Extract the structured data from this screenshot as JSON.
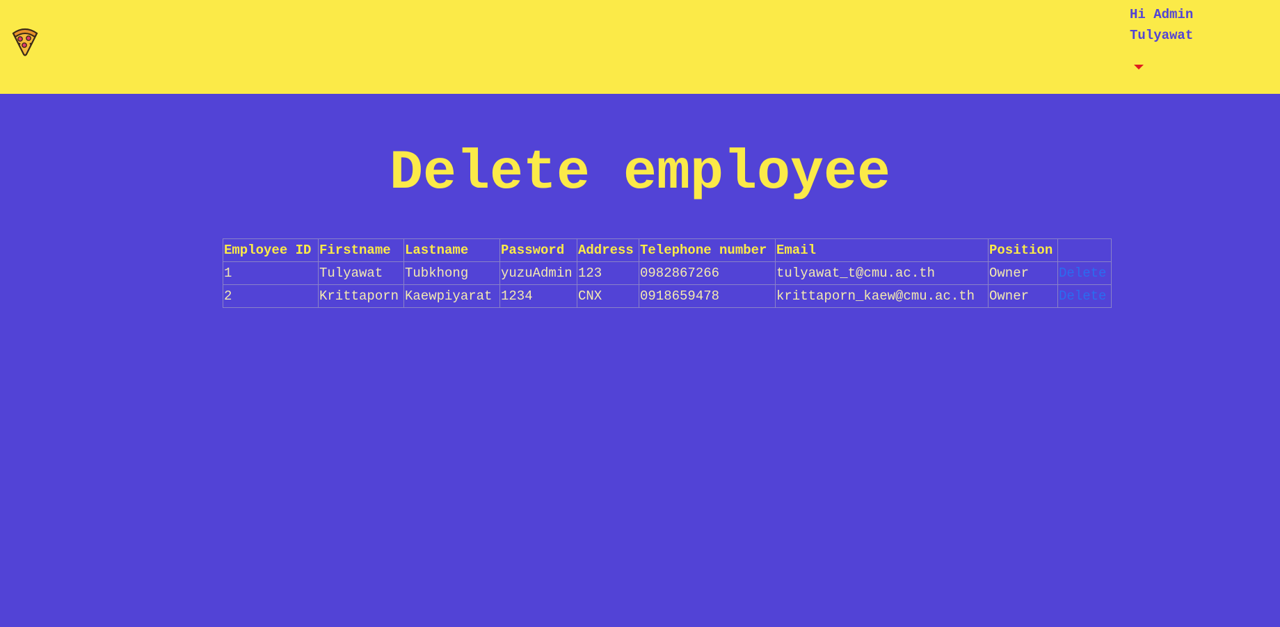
{
  "header": {
    "logo_icon": "pizza-icon",
    "greeting_line1": "Hi Admin",
    "greeting_line2": "Tulyawat",
    "dropdown_icon": "caret-down-icon",
    "colors": {
      "bar": "#fbea48",
      "text": "#5243d6",
      "caret": "#e01e1e"
    }
  },
  "page": {
    "title": "Delete employee",
    "colors": {
      "background": "#5243d6",
      "title": "#fbea48",
      "link": "#2b6cf0"
    }
  },
  "table": {
    "headers": [
      "Employee ID",
      "Firstname",
      "Lastname",
      "Password",
      "Address",
      "Telephone number",
      "Email",
      "Position",
      ""
    ],
    "rows": [
      {
        "id": "1",
        "firstname": "Tulyawat",
        "lastname": "Tubkhong",
        "password": "yuzuAdmin",
        "address": "123",
        "telephone": "0982867266",
        "email": "tulyawat_t@cmu.ac.th",
        "position": "Owner",
        "action": "Delete"
      },
      {
        "id": "2",
        "firstname": "Krittaporn",
        "lastname": "Kaewpiyarat",
        "password": "1234",
        "address": "CNX",
        "telephone": "0918659478",
        "email": "krittaporn_kaew@cmu.ac.th",
        "position": "Owner",
        "action": "Delete"
      }
    ]
  }
}
